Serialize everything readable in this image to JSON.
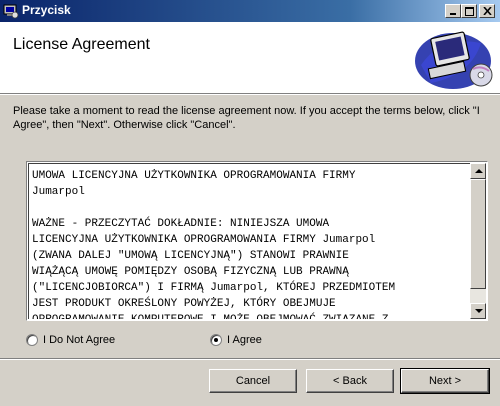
{
  "window": {
    "title": "Przycisk"
  },
  "header": {
    "title": "License Agreement"
  },
  "intro_text": "Please take a moment to read the license agreement now. If you accept the terms below, click \"I Agree\", then \"Next\". Otherwise click \"Cancel\".",
  "license": {
    "text": "UMOWA LICENCYJNA UŻYTKOWNIKA OPROGRAMOWANIA FIRMY\nJumarpol\n\nWAŻNE - PRZECZYTAĆ DOKŁADNIE: NINIEJSZA UMOWA\nLICENCYJNA UŻYTKOWNIKA OPROGRAMOWANIA FIRMY Jumarpol\n(ZWANA DALEJ \"UMOWĄ LICENCYJNĄ\") STANOWI PRAWNIE\nWIĄŻĄCĄ UMOWĘ POMIĘDZY OSOBĄ FIZYCZNĄ LUB PRAWNĄ\n(\"LICENCJOBIORCA\") I FIRMĄ Jumarpol, KTÓREJ PRZEDMIOTEM\nJEST PRODUKT OKREŚLONY POWYŻEJ, KTÓRY OBEJMUJE\nOPROGRAMOWANIE KOMPUTEROWE I MOŻE OBEJMOWAĆ ZWIĄZANE Z"
  },
  "options": {
    "disagree_label": "I Do Not Agree",
    "agree_label": "I Agree",
    "selected": "agree"
  },
  "buttons": {
    "cancel": "Cancel",
    "back": "< Back",
    "next": "Next >"
  },
  "icons": {
    "app": "installer-app-icon",
    "header_art": "computer-monitor-cd-icon"
  }
}
